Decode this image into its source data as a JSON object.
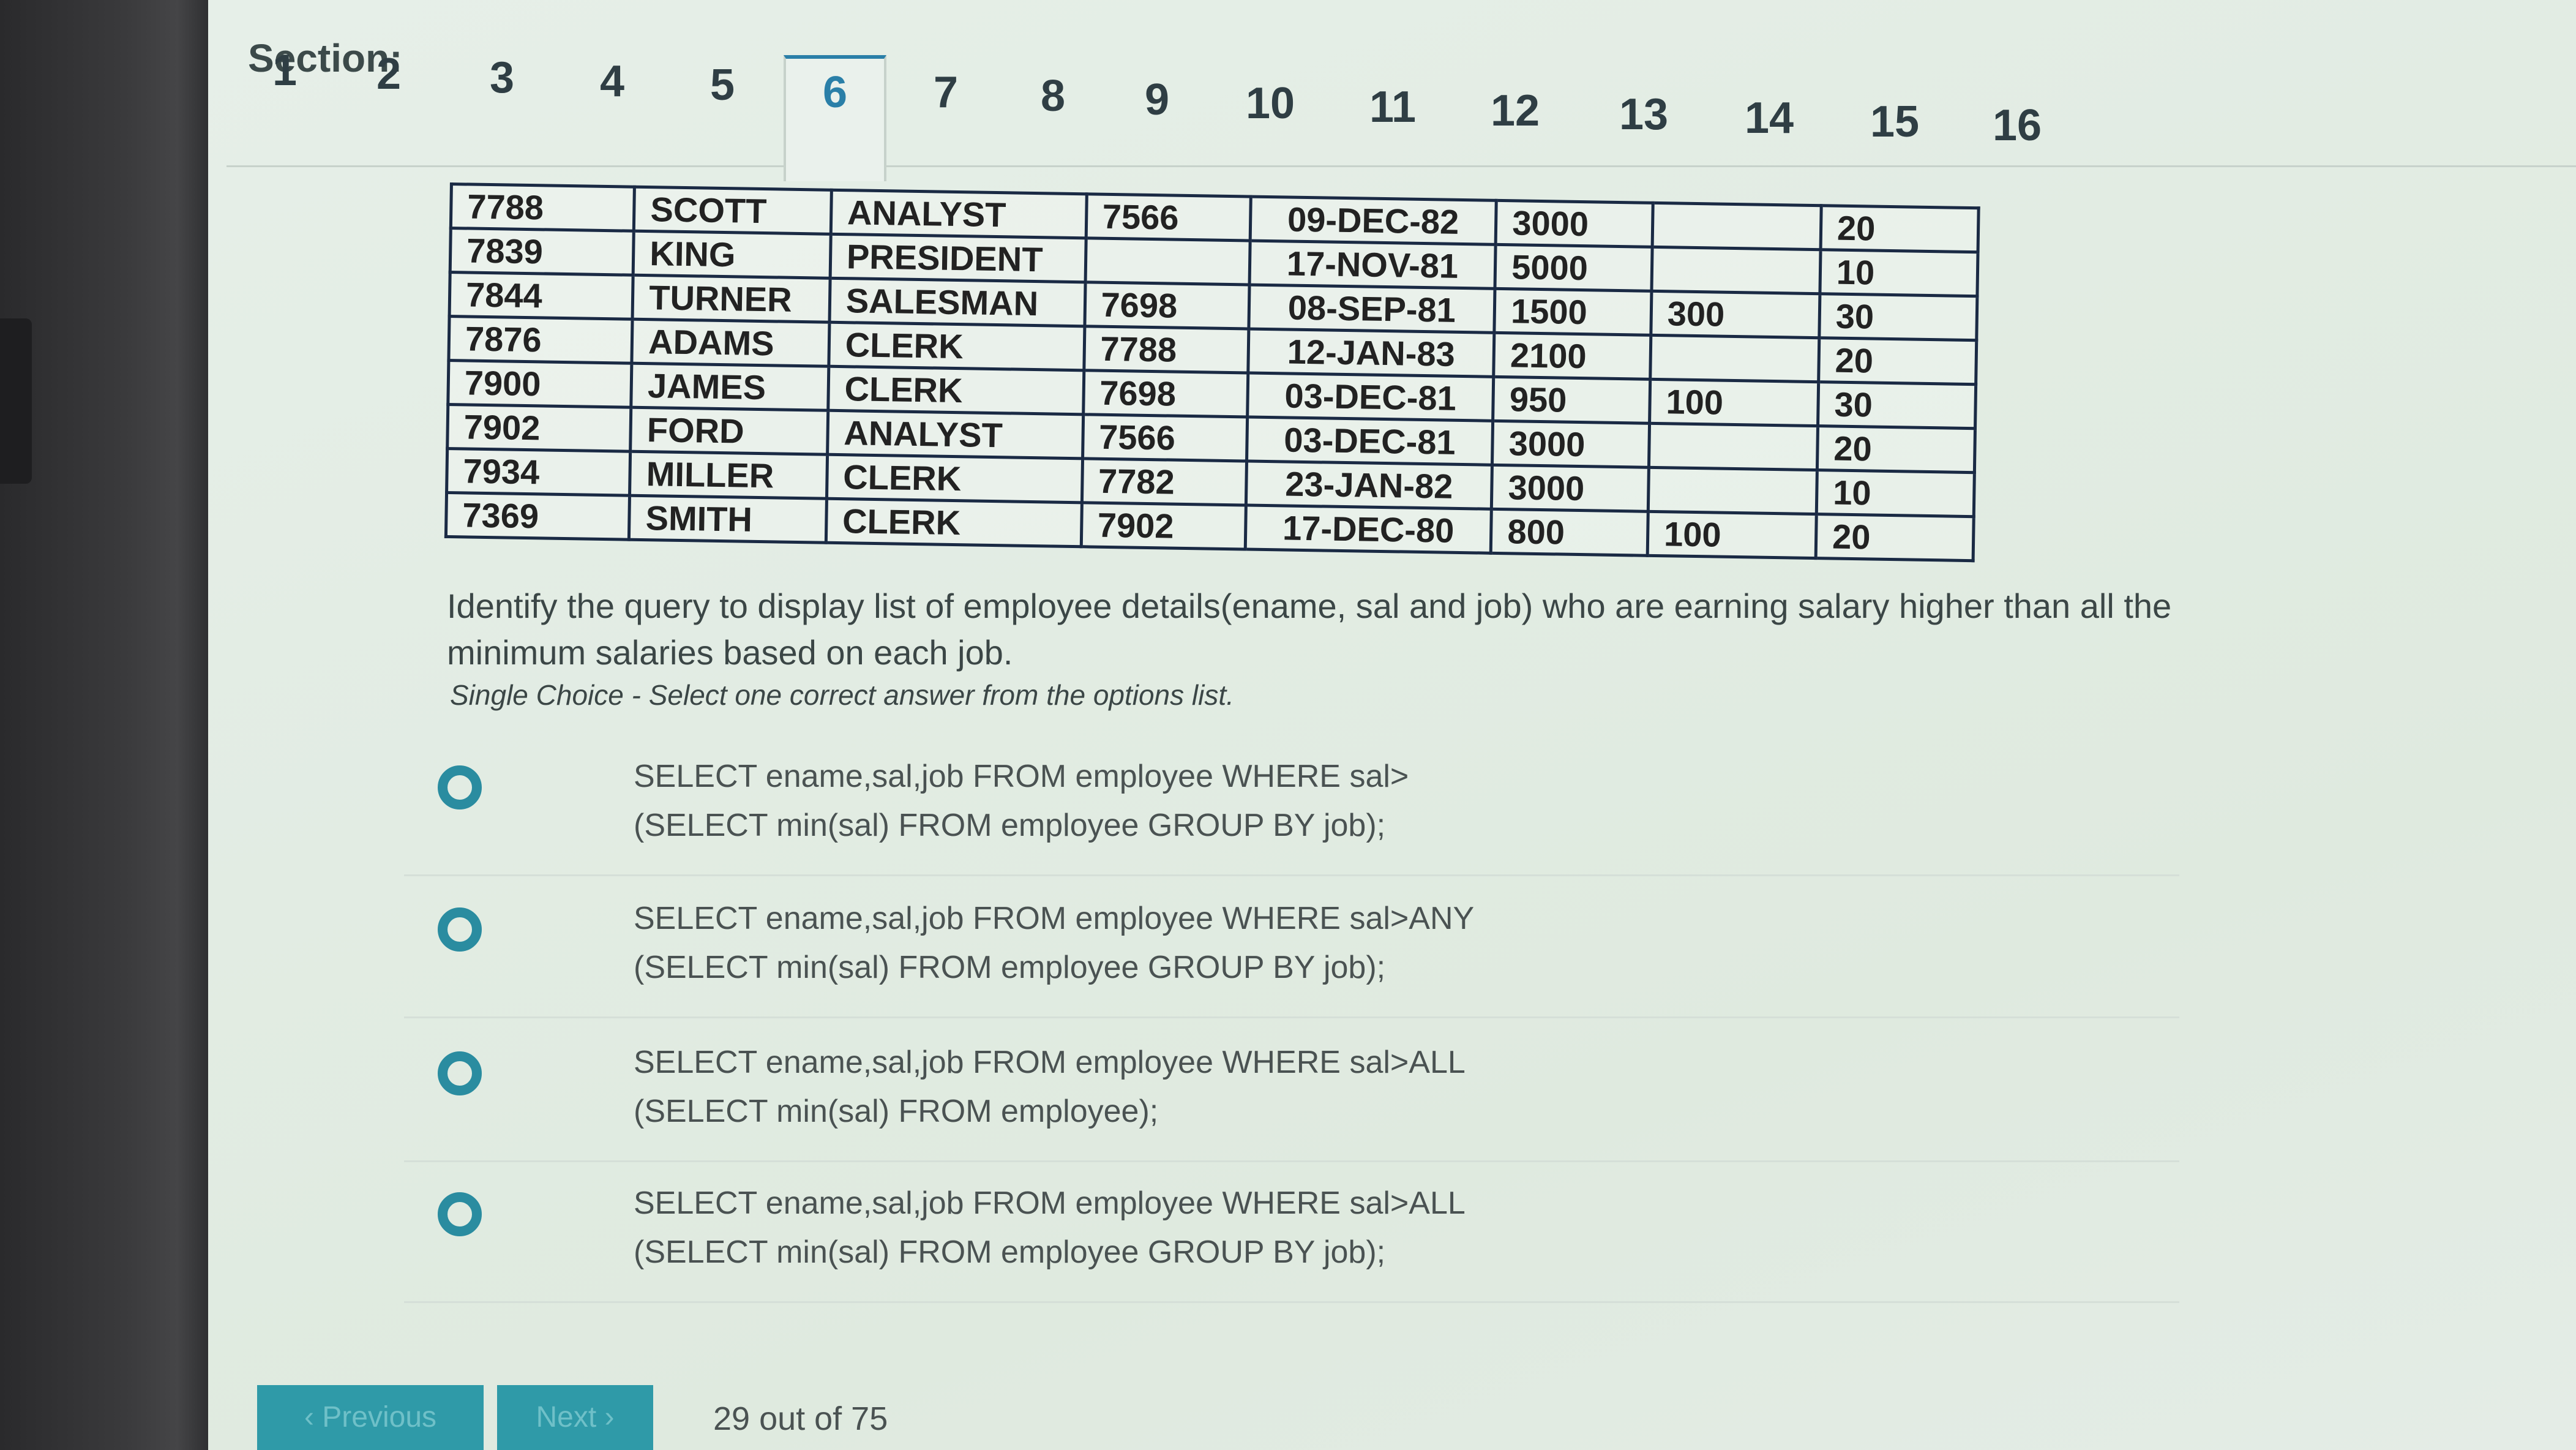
{
  "section": {
    "label": "Section:",
    "tabs": [
      "1",
      "2",
      "3",
      "4",
      "5",
      "6",
      "7",
      "8",
      "9",
      "10",
      "11",
      "12",
      "13",
      "14",
      "15",
      "16"
    ],
    "active": "6"
  },
  "table": {
    "rows": [
      [
        "7788",
        "SCOTT",
        "ANALYST",
        "7566",
        "09-DEC-82",
        "3000",
        "",
        "20"
      ],
      [
        "7839",
        "KING",
        "PRESIDENT",
        "",
        "17-NOV-81",
        "5000",
        "",
        "10"
      ],
      [
        "7844",
        "TURNER",
        "SALESMAN",
        "7698",
        "08-SEP-81",
        "1500",
        "300",
        "30"
      ],
      [
        "7876",
        "ADAMS",
        "CLERK",
        "7788",
        "12-JAN-83",
        "2100",
        "",
        "20"
      ],
      [
        "7900",
        "JAMES",
        "CLERK",
        "7698",
        "03-DEC-81",
        "950",
        "100",
        "30"
      ],
      [
        "7902",
        "FORD",
        "ANALYST",
        "7566",
        "03-DEC-81",
        "3000",
        "",
        "20"
      ],
      [
        "7934",
        "MILLER",
        "CLERK",
        "7782",
        "23-JAN-82",
        "3000",
        "",
        "10"
      ],
      [
        "7369",
        "SMITH",
        "CLERK",
        "7902",
        "17-DEC-80",
        "800",
        "100",
        "20"
      ]
    ]
  },
  "question": {
    "text": "Identify the query to display list of employee details(ename, sal and job) who are earning salary higher than all the minimum salaries based on each job.",
    "hint": "Single Choice - Select one correct answer from the options list."
  },
  "options": [
    {
      "line1": "SELECT ename,sal,job FROM employee WHERE sal>",
      "line2": "(SELECT min(sal) FROM employee GROUP BY job);"
    },
    {
      "line1": "SELECT ename,sal,job FROM employee WHERE sal>ANY",
      "line2": "(SELECT min(sal) FROM employee GROUP BY job);"
    },
    {
      "line1": "SELECT ename,sal,job FROM employee WHERE sal>ALL",
      "line2": "(SELECT min(sal) FROM employee);"
    },
    {
      "line1": "SELECT ename,sal,job FROM employee WHERE sal>ALL",
      "line2": "(SELECT min(sal) FROM employee GROUP BY job);"
    }
  ],
  "nav": {
    "previous": "‹ Previous",
    "next": "Next ›",
    "progress": "29 out of 75"
  },
  "colors": {
    "accent": "#2a8ca0",
    "active_tab": "#2a7fa8"
  }
}
